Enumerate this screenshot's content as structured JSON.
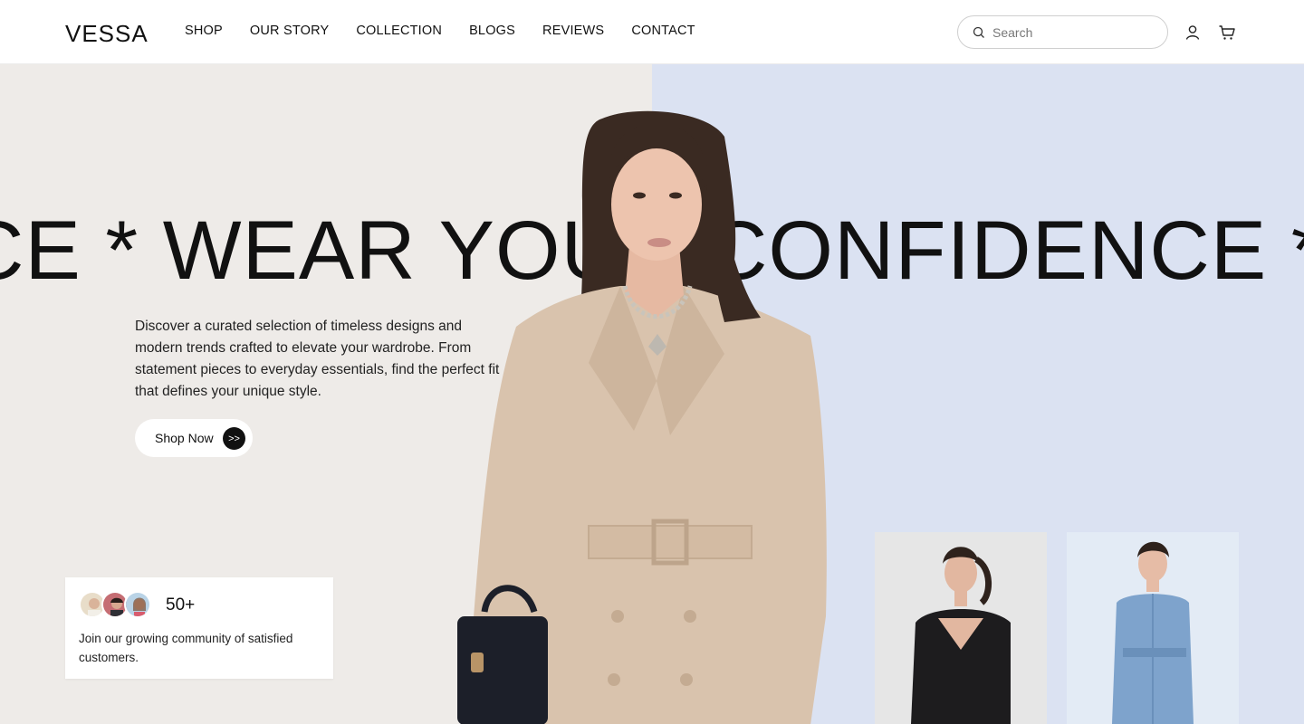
{
  "brand": {
    "logo": "VESSA"
  },
  "nav": {
    "items": [
      "SHOP",
      "OUR STORY",
      "COLLECTION",
      "BLOGS",
      "REVIEWS",
      "CONTACT"
    ]
  },
  "search": {
    "placeholder": "Search"
  },
  "hero": {
    "marquee": "CE * WEAR YOUR CONFIDENCE * W",
    "description": "Discover a curated selection of timeless designs and modern trends crafted to elevate your wardrobe. From statement pieces to everyday essentials, find the perfect fit that defines your unique style.",
    "cta_label": "Shop Now",
    "cta_icon": ">>"
  },
  "community": {
    "count": "50+",
    "text": "Join our growing community of satisfied customers."
  },
  "colors": {
    "left_bg": "#eeebe8",
    "right_bg": "#dbe2f2",
    "coat": "#d9c3ad",
    "text": "#111111"
  },
  "icons": {
    "search": "search-icon",
    "user": "user-icon",
    "cart": "cart-icon"
  }
}
